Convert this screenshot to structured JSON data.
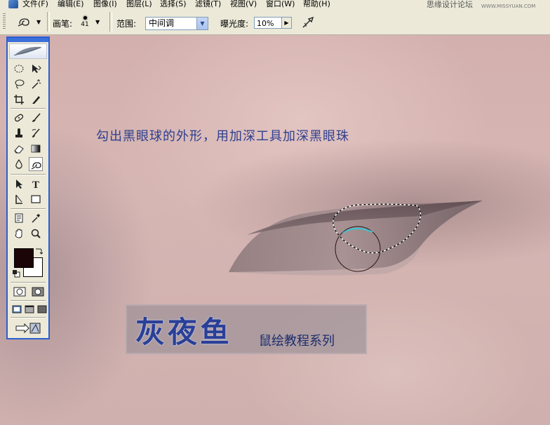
{
  "menubar": {
    "items": [
      "文件(F)",
      "编辑(E)",
      "图像(I)",
      "图层(L)",
      "选择(S)",
      "滤镜(T)",
      "视图(V)",
      "窗口(W)",
      "帮助(H)"
    ],
    "watermark": "思缘设计论坛",
    "watermark_url": "WWW.MISSYUAN.COM"
  },
  "options": {
    "brush_label": "画笔:",
    "brush_size": "41",
    "range_label": "范围:",
    "range_value": "中间调",
    "exposure_label": "曝光度:",
    "exposure_value": "10%"
  },
  "canvas": {
    "instruction": "勾出黑眼球的外形，用加深工具加深黑眼珠",
    "brand_title": "灰夜鱼",
    "brand_subtitle": "鼠绘教程系列"
  },
  "toolbox": {
    "foreground_color": "#1c0507",
    "background_color": "#ffffff",
    "active_tool": "burn-tool"
  },
  "colors": {
    "chrome": "#ece9d8",
    "toolbox_border": "#2d5fcf",
    "text_blue": "#2e3f8f",
    "selection_highlight": "#39c7d6"
  }
}
